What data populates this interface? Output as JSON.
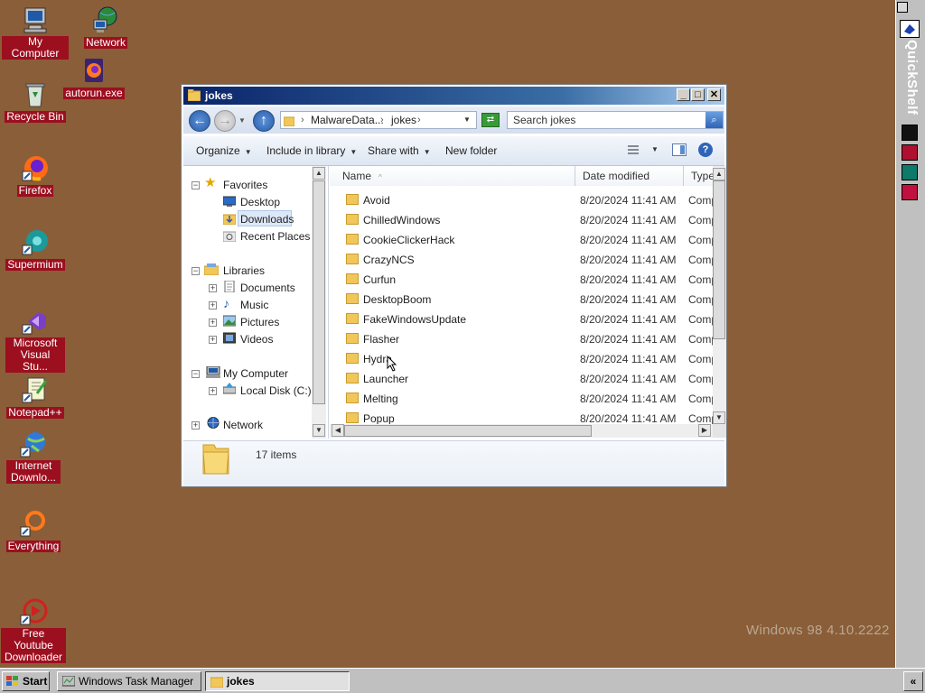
{
  "desktop": {
    "icons": [
      {
        "label": "My Computer"
      },
      {
        "label": "Network"
      },
      {
        "label": "autorun.exe"
      },
      {
        "label": "Recycle Bin"
      },
      {
        "label": "Firefox"
      },
      {
        "label": "Supermium"
      },
      {
        "label": "Microsoft Visual Stu..."
      },
      {
        "label": "Notepad++"
      },
      {
        "label": "Internet Downlo..."
      },
      {
        "label": "Everything"
      },
      {
        "label": "Free Youtube Downloader"
      }
    ],
    "watermark": "Windows 98 4.10.2222"
  },
  "quickshelf": {
    "title": "QuickShelf",
    "colors": {
      "item1": "#1d3fb0",
      "item2": "#111111",
      "item3": "#b01030",
      "item4": "#0d7a6a",
      "item5": "#c01040"
    }
  },
  "window": {
    "title": "jokes",
    "buttons": {
      "minimize": "_",
      "maximize": "□",
      "close": "✕"
    },
    "address": {
      "crumbs": [
        "MalwareData...",
        "jokes"
      ],
      "search_placeholder": "Search jokes"
    },
    "toolbar": {
      "organize": "Organize",
      "include": "Include in library",
      "share": "Share with",
      "new_folder": "New folder"
    },
    "nav": {
      "favorites": "Favorites",
      "desktop": "Desktop",
      "downloads": "Downloads",
      "recent": "Recent Places",
      "libraries": "Libraries",
      "documents": "Documents",
      "music": "Music",
      "pictures": "Pictures",
      "videos": "Videos",
      "my_computer": "My Computer",
      "local_disk": "Local Disk (C:)",
      "network": "Network"
    },
    "columns": {
      "name": "Name",
      "date": "Date modified",
      "type": "Type"
    },
    "files": [
      {
        "name": "Avoid",
        "date": "8/20/2024 11:41 AM",
        "type": "Comp"
      },
      {
        "name": "ChilledWindows",
        "date": "8/20/2024 11:41 AM",
        "type": "Comp"
      },
      {
        "name": "CookieClickerHack",
        "date": "8/20/2024 11:41 AM",
        "type": "Comp"
      },
      {
        "name": "CrazyNCS",
        "date": "8/20/2024 11:41 AM",
        "type": "Comp"
      },
      {
        "name": "Curfun",
        "date": "8/20/2024 11:41 AM",
        "type": "Comp"
      },
      {
        "name": "DesktopBoom",
        "date": "8/20/2024 11:41 AM",
        "type": "Comp"
      },
      {
        "name": "FakeWindowsUpdate",
        "date": "8/20/2024 11:41 AM",
        "type": "Comp"
      },
      {
        "name": "Flasher",
        "date": "8/20/2024 11:41 AM",
        "type": "Comp"
      },
      {
        "name": "Hydra",
        "date": "8/20/2024 11:41 AM",
        "type": "Comp"
      },
      {
        "name": "Launcher",
        "date": "8/20/2024 11:41 AM",
        "type": "Comp"
      },
      {
        "name": "Melting",
        "date": "8/20/2024 11:41 AM",
        "type": "Comp"
      },
      {
        "name": "Popup",
        "date": "8/20/2024 11:41 AM",
        "type": "Comp"
      }
    ],
    "details": {
      "count": "17 items"
    }
  },
  "taskbar": {
    "start": "Start",
    "tasks": [
      "Windows Task Manager",
      "jokes"
    ],
    "tray_arrow": "«"
  },
  "colors": {
    "desktop_bg": "#8a5e38",
    "label_bg": "#9c0f1f",
    "titlebar": "#0a246a"
  }
}
